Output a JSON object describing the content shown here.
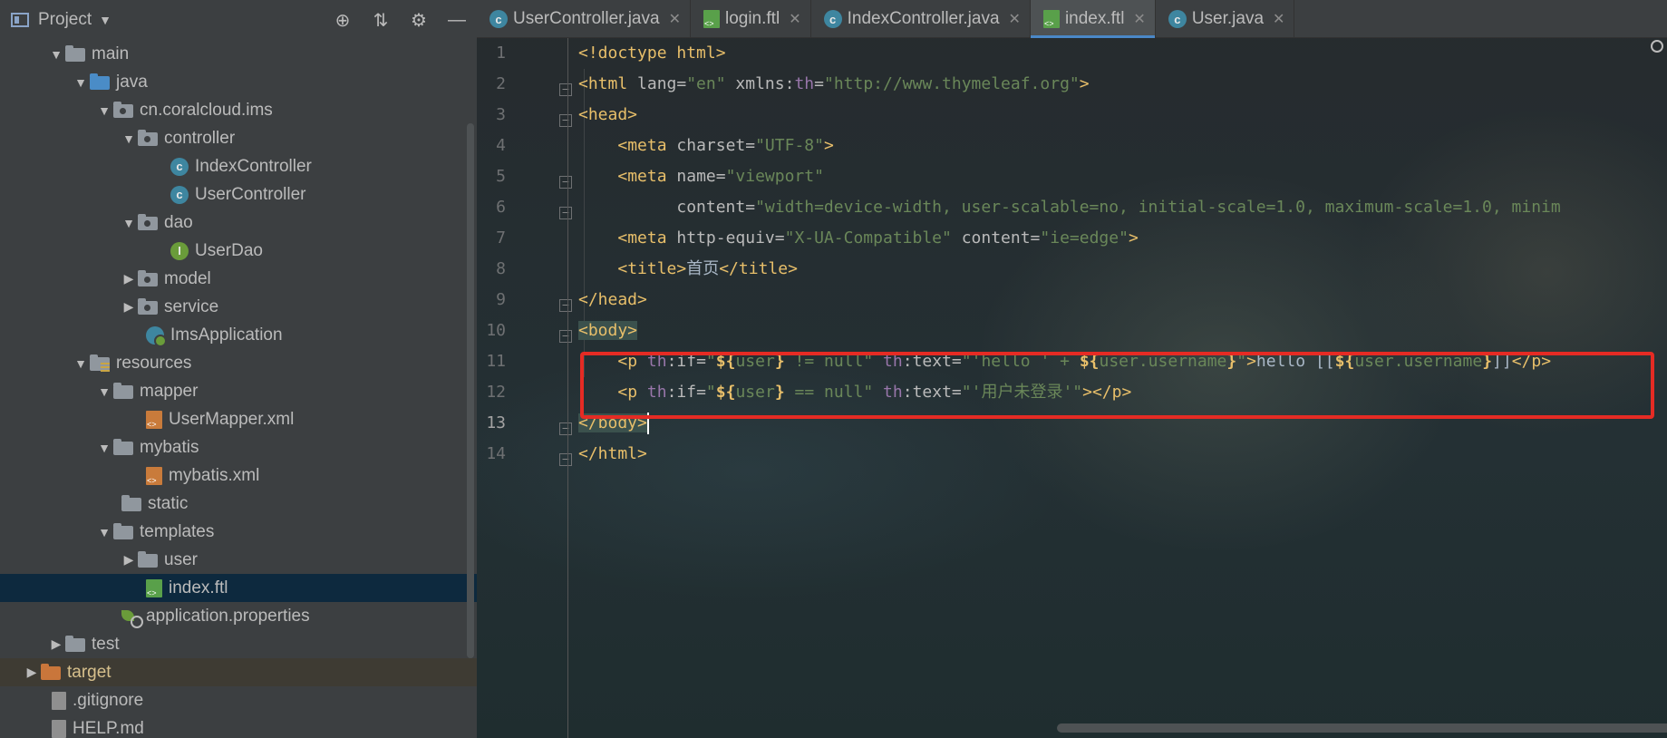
{
  "project_panel": {
    "title": "Project",
    "tools": [
      "locate-icon",
      "collapse-icon",
      "gear-icon",
      "minimize-icon"
    ],
    "tree": [
      {
        "label": "main",
        "kind": "folder",
        "expanded": true
      },
      {
        "label": "java",
        "kind": "source-folder",
        "expanded": true
      },
      {
        "label": "cn.coralcloud.ims",
        "kind": "package",
        "expanded": true
      },
      {
        "label": "controller",
        "kind": "package",
        "expanded": true
      },
      {
        "label": "IndexController",
        "kind": "class"
      },
      {
        "label": "UserController",
        "kind": "class"
      },
      {
        "label": "dao",
        "kind": "package",
        "expanded": true
      },
      {
        "label": "UserDao",
        "kind": "interface"
      },
      {
        "label": "model",
        "kind": "package",
        "expanded": false
      },
      {
        "label": "service",
        "kind": "package",
        "expanded": false
      },
      {
        "label": "ImsApplication",
        "kind": "application"
      },
      {
        "label": "resources",
        "kind": "resources-folder",
        "expanded": true
      },
      {
        "label": "mapper",
        "kind": "folder",
        "expanded": true
      },
      {
        "label": "UserMapper.xml",
        "kind": "xml"
      },
      {
        "label": "mybatis",
        "kind": "folder",
        "expanded": true
      },
      {
        "label": "mybatis.xml",
        "kind": "xml"
      },
      {
        "label": "static",
        "kind": "folder"
      },
      {
        "label": "templates",
        "kind": "folder",
        "expanded": true
      },
      {
        "label": "user",
        "kind": "folder",
        "expanded": false
      },
      {
        "label": "index.ftl",
        "kind": "ftl",
        "selected": true
      },
      {
        "label": "application.properties",
        "kind": "properties"
      },
      {
        "label": "test",
        "kind": "folder",
        "expanded": false
      },
      {
        "label": "target",
        "kind": "excluded-folder",
        "expanded": false
      },
      {
        "label": ".gitignore",
        "kind": "file"
      },
      {
        "label": "HELP.md",
        "kind": "markdown"
      }
    ]
  },
  "tabs": [
    {
      "label": "UserController.java",
      "icon": "class-icon",
      "active": false
    },
    {
      "label": "login.ftl",
      "icon": "ftl-icon",
      "active": false
    },
    {
      "label": "IndexController.java",
      "icon": "class-icon",
      "active": false
    },
    {
      "label": "index.ftl",
      "icon": "ftl-icon",
      "active": true
    },
    {
      "label": "User.java",
      "icon": "class-icon",
      "active": false
    }
  ],
  "editor": {
    "line_numbers": [
      "1",
      "2",
      "3",
      "4",
      "5",
      "6",
      "7",
      "8",
      "9",
      "10",
      "11",
      "12",
      "13",
      "14"
    ],
    "lines": [
      "<!doctype html>",
      "<html lang=\"en\" xmlns:th=\"http://www.thymeleaf.org\">",
      "<head>",
      "    <meta charset=\"UTF-8\">",
      "    <meta name=\"viewport\"",
      "          content=\"width=device-width, user-scalable=no, initial-scale=1.0, maximum-scale=1.0, minim",
      "    <meta http-equiv=\"X-UA-Compatible\" content=\"ie=edge\">",
      "    <title>首页</title>",
      "</head>",
      "<body>",
      "    <p th:if=\"${user} != null\" th:text=\"'hello ' + ${user.username}\">hello [[${user.username}]]</p>",
      "    <p th:if=\"${user} == null\" th:text=\"'用户未登录'\"></p>",
      "</body>",
      "</html>"
    ],
    "highlight_color": "#e52b24"
  },
  "colors": {
    "tag": "#e8bf6a",
    "attribute_value": "#6a8759",
    "namespace": "#9876aa",
    "text": "#a9b7c6",
    "line_number": "#6e7072",
    "active_tab_underline": "#4a88c7"
  }
}
